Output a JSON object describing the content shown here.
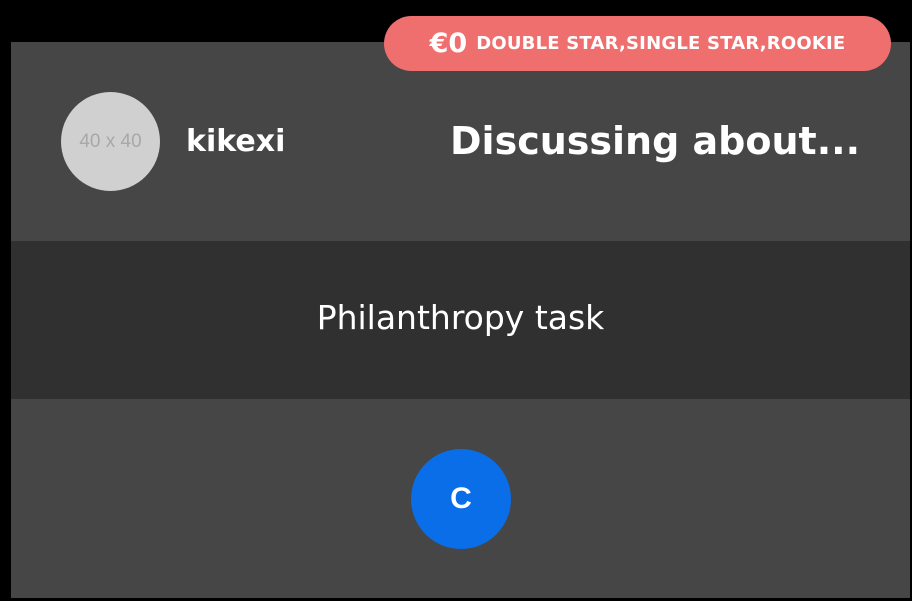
{
  "badge": {
    "amount": "€0",
    "levels": "DOUBLE STAR,SINGLE STAR,ROOKIE"
  },
  "user": {
    "avatar_placeholder": "40 x 40",
    "name": "kikexi"
  },
  "header": {
    "title": "Discussing about..."
  },
  "task": {
    "label": "Philanthropy task"
  },
  "action": {
    "button_label": "C"
  },
  "colors": {
    "background": "#000000",
    "card": "#464646",
    "task_band": "#303030",
    "badge": "#ef6f6f",
    "button": "#0a6ee8",
    "text": "#ffffff"
  }
}
